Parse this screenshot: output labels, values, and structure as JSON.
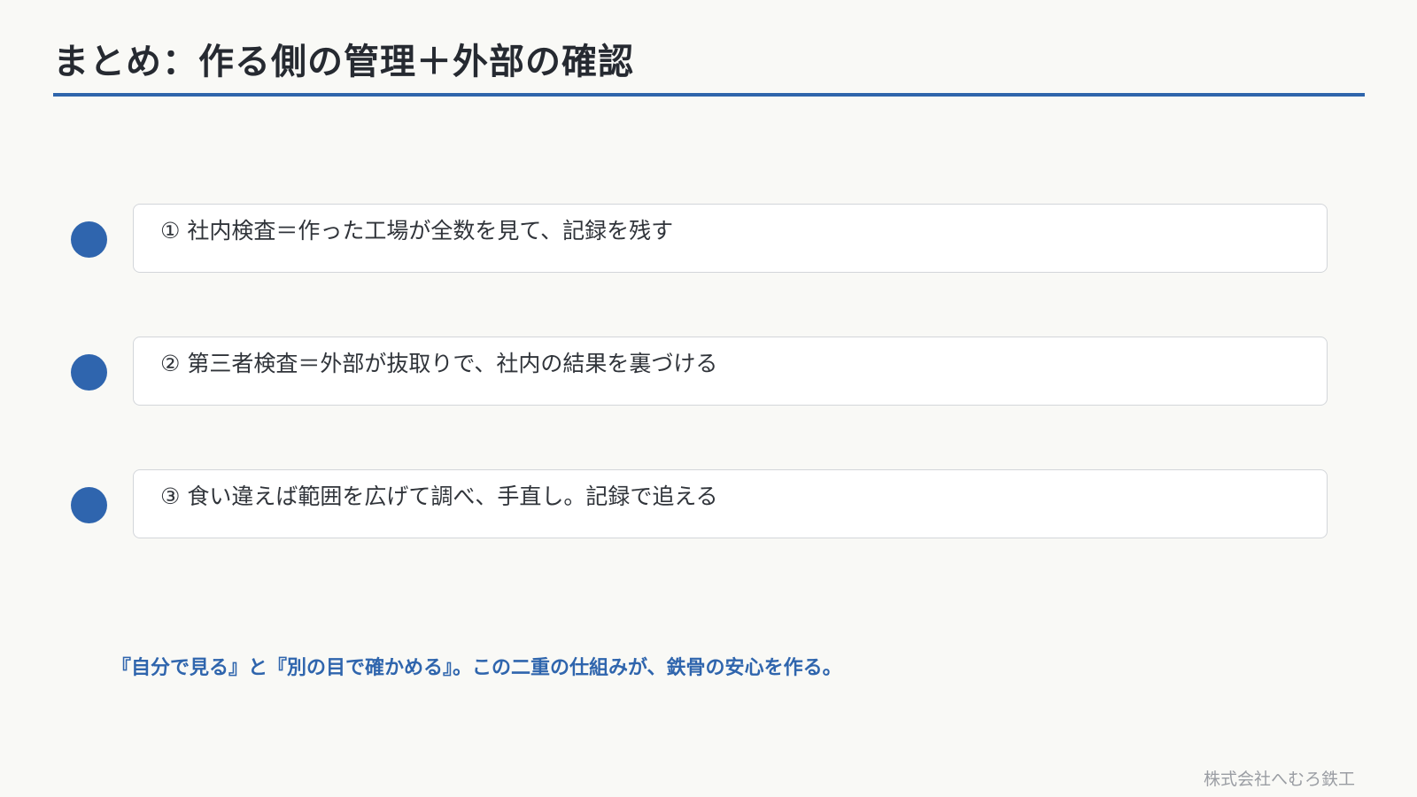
{
  "slide": {
    "title": "まとめ：作る側の管理＋外部の確認",
    "items": [
      {
        "text": "① 社内検査＝作った工場が全数を見て、記録を残す"
      },
      {
        "text": "② 第三者検査＝外部が抜取りで、社内の結果を裏づける"
      },
      {
        "text": "③ 食い違えば範囲を広げて調べ、手直し。記録で追える"
      }
    ],
    "summary": "『自分で見る』と『別の目で確かめる』。この二重の仕組みが、鉄骨の安心を作る。",
    "footer": "株式会社へむろ鉄工"
  },
  "colors": {
    "accent": "#2f65ab",
    "title_text": "#262a31",
    "body_text": "#30343a",
    "footer_text": "#9a9da3",
    "background": "#f9f9f6",
    "card_border": "#d3d6da"
  }
}
